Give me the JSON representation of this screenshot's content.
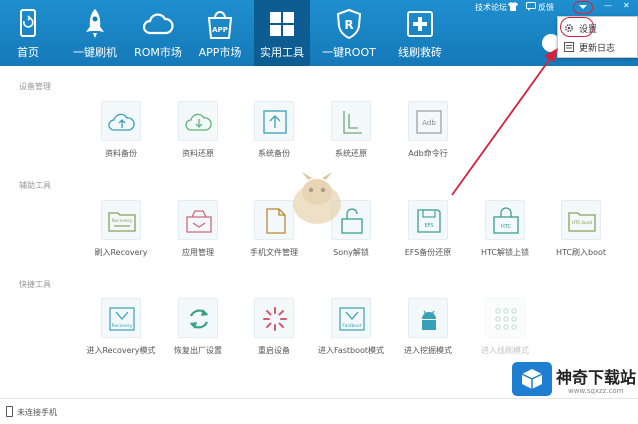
{
  "nav": {
    "items": [
      {
        "label": "首页",
        "icon": "phone-icon"
      },
      {
        "label": "一键刷机",
        "icon": "rocket-icon"
      },
      {
        "label": "ROM市场",
        "icon": "cloud-icon"
      },
      {
        "label": "APP市场",
        "icon": "app-bag-icon",
        "badge": "APP"
      },
      {
        "label": "实用工具",
        "icon": "grid-icon",
        "active": true
      },
      {
        "label": "一键ROOT",
        "icon": "root-shield-icon",
        "badge": "R"
      },
      {
        "label": "线刷救砖",
        "icon": "plus-box-icon"
      }
    ]
  },
  "topright": {
    "forum": "技术论坛",
    "feedback": "反馈",
    "minimize": "—",
    "close": "✕"
  },
  "menu": {
    "items": [
      {
        "label": "设置",
        "icon": "gear-icon"
      },
      {
        "label": "更新日志",
        "icon": "log-icon"
      }
    ]
  },
  "sections": [
    {
      "title": "设备管理",
      "tools": [
        {
          "label": "资料备份",
          "icon": "cloud-upload-icon"
        },
        {
          "label": "资料还原",
          "icon": "cloud-download-icon"
        },
        {
          "label": "系统备份",
          "icon": "upload-arrow-icon"
        },
        {
          "label": "系统还原",
          "icon": "restore-icon"
        },
        {
          "label": "Adb命令行",
          "icon": "adb-icon",
          "badge": "Adb"
        }
      ]
    },
    {
      "title": "辅助工具",
      "tools": [
        {
          "label": "刷入Recovery",
          "icon": "recovery-folder-icon",
          "badge": "Recovery"
        },
        {
          "label": "应用管理",
          "icon": "app-manage-icon"
        },
        {
          "label": "手机文件管理",
          "icon": "file-manage-icon"
        },
        {
          "label": "Sony解锁",
          "icon": "unlock-icon"
        },
        {
          "label": "EFS备份还原",
          "icon": "efs-icon",
          "badge": "EFS"
        },
        {
          "label": "HTC解锁上锁",
          "icon": "htc-lock-icon",
          "badge": "HTC"
        },
        {
          "label": "HTC刷入boot",
          "icon": "htc-boot-icon",
          "badge": "HTC-boot"
        }
      ]
    },
    {
      "title": "快捷工具",
      "tools": [
        {
          "label": "进入Recovery模式",
          "icon": "recovery-mode-icon",
          "badge": "Recovery"
        },
        {
          "label": "恢复出厂设置",
          "icon": "refresh-icon"
        },
        {
          "label": "重启设备",
          "icon": "spinner-icon"
        },
        {
          "label": "进入Fastboot模式",
          "icon": "fastboot-icon",
          "badge": "Fastboot"
        },
        {
          "label": "进入挖掘模式",
          "icon": "android-icon"
        },
        {
          "label": "进入线刷模式",
          "icon": "dots-icon",
          "faded": true
        }
      ]
    }
  ],
  "status": {
    "text": "未连接手机"
  },
  "watermark": {
    "title": "神奇下载站",
    "url": "www.sqxzz.com"
  },
  "colors": {
    "accent": "#1a87c8",
    "active": "#0d5c92",
    "tool_icon": "#3aa0b8",
    "annotation": "#d6203b"
  }
}
